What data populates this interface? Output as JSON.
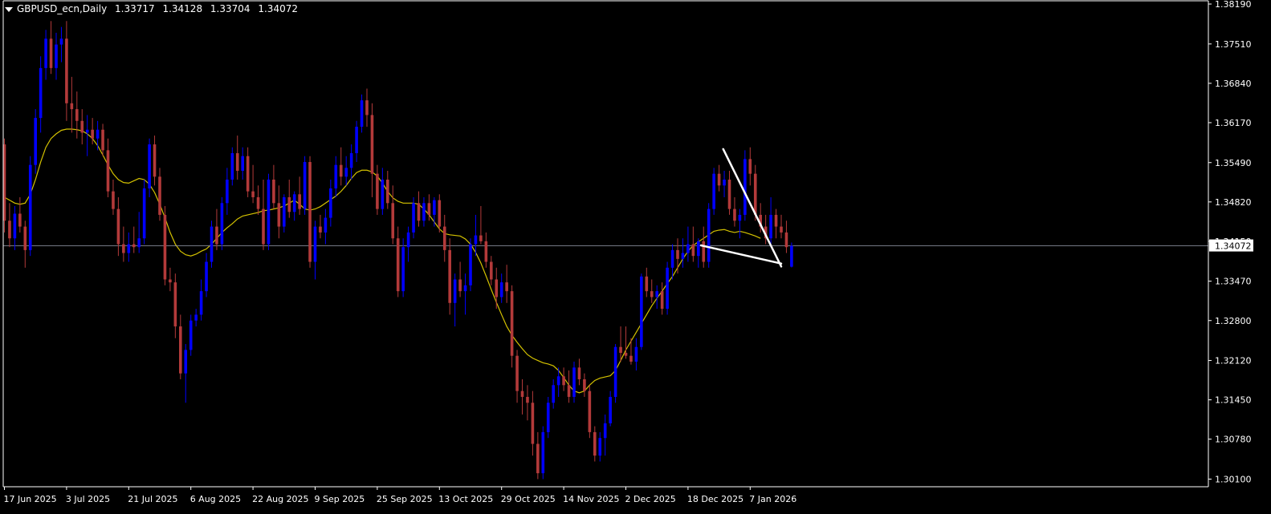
{
  "header": {
    "symbol": "GBPUSD_ecn,Daily",
    "open": "1.33717",
    "high": "1.34128",
    "low": "1.33704",
    "close": "1.34072"
  },
  "colors": {
    "background": "#000000",
    "bull": "#0000ff",
    "bear": "#b33a3a",
    "ma": "#d4c200",
    "axis": "#ffffff",
    "pattern": "#ffffff",
    "price_line": "#9aa0b0"
  },
  "chart_data": {
    "type": "candlestick",
    "y_ticks": [
      "1.38190",
      "1.37510",
      "1.36840",
      "1.36170",
      "1.35490",
      "1.34820",
      "1.34150",
      "1.33470",
      "1.32800",
      "1.32120",
      "1.31450",
      "1.30780",
      "1.30100"
    ],
    "ylim": [
      1.2997,
      1.38245
    ],
    "x_ticks": [
      {
        "label": "17 Jun 2025",
        "index": 0
      },
      {
        "label": "3 Jul 2025",
        "index": 12
      },
      {
        "label": "21 Jul 2025",
        "index": 24
      },
      {
        "label": "6 Aug 2025",
        "index": 36
      },
      {
        "label": "22 Aug 2025",
        "index": 48
      },
      {
        "label": "9 Sep 2025",
        "index": 60
      },
      {
        "label": "25 Sep 2025",
        "index": 72
      },
      {
        "label": "13 Oct 2025",
        "index": 84
      },
      {
        "label": "29 Oct 2025",
        "index": 96
      },
      {
        "label": "14 Nov 2025",
        "index": 108
      },
      {
        "label": "2 Dec 2025",
        "index": 120
      },
      {
        "label": "18 Dec 2025",
        "index": 132
      },
      {
        "label": "7 Jan 2026",
        "index": 144
      }
    ],
    "current_price": "1.34072",
    "candles": [
      [
        1.358,
        1.359,
        1.343,
        1.345
      ],
      [
        1.345,
        1.348,
        1.3405,
        1.342
      ],
      [
        1.342,
        1.3475,
        1.34,
        1.3462
      ],
      [
        1.3462,
        1.349,
        1.343,
        1.344
      ],
      [
        1.344,
        1.345,
        1.337,
        1.34
      ],
      [
        1.34,
        1.356,
        1.339,
        1.3545
      ],
      [
        1.3545,
        1.364,
        1.353,
        1.3625
      ],
      [
        1.3625,
        1.373,
        1.36,
        1.371
      ],
      [
        1.371,
        1.3775,
        1.369,
        1.376
      ],
      [
        1.376,
        1.379,
        1.37,
        1.371
      ],
      [
        1.371,
        1.377,
        1.369,
        1.375
      ],
      [
        1.375,
        1.378,
        1.372,
        1.376
      ],
      [
        1.376,
        1.379,
        1.362,
        1.365
      ],
      [
        1.365,
        1.3695,
        1.36,
        1.364
      ],
      [
        1.364,
        1.367,
        1.359,
        1.362
      ],
      [
        1.362,
        1.364,
        1.358,
        1.36
      ],
      [
        1.36,
        1.363,
        1.356,
        1.3605
      ],
      [
        1.3605,
        1.3625,
        1.358,
        1.359
      ],
      [
        1.359,
        1.362,
        1.357,
        1.3605
      ],
      [
        1.3605,
        1.3615,
        1.356,
        1.357
      ],
      [
        1.357,
        1.359,
        1.349,
        1.35
      ],
      [
        1.35,
        1.352,
        1.346,
        1.347
      ],
      [
        1.347,
        1.349,
        1.339,
        1.341
      ],
      [
        1.341,
        1.344,
        1.338,
        1.3395
      ],
      [
        1.3395,
        1.343,
        1.338,
        1.341
      ],
      [
        1.341,
        1.344,
        1.3395,
        1.3405
      ],
      [
        1.3405,
        1.3465,
        1.3395,
        1.342
      ],
      [
        1.342,
        1.352,
        1.341,
        1.3505
      ],
      [
        1.3505,
        1.359,
        1.349,
        1.358
      ],
      [
        1.358,
        1.3595,
        1.351,
        1.3525
      ],
      [
        1.3525,
        1.354,
        1.345,
        1.346
      ],
      [
        1.346,
        1.3475,
        1.334,
        1.335
      ],
      [
        1.335,
        1.337,
        1.333,
        1.3345
      ],
      [
        1.3345,
        1.336,
        1.325,
        1.327
      ],
      [
        1.327,
        1.329,
        1.318,
        1.319
      ],
      [
        1.319,
        1.324,
        1.314,
        1.323
      ],
      [
        1.323,
        1.329,
        1.322,
        1.328
      ],
      [
        1.328,
        1.33,
        1.327,
        1.329
      ],
      [
        1.329,
        1.335,
        1.328,
        1.333
      ],
      [
        1.333,
        1.3395,
        1.332,
        1.338
      ],
      [
        1.338,
        1.345,
        1.337,
        1.344
      ],
      [
        1.344,
        1.347,
        1.34,
        1.341
      ],
      [
        1.341,
        1.349,
        1.34,
        1.348
      ],
      [
        1.348,
        1.354,
        1.346,
        1.352
      ],
      [
        1.352,
        1.3575,
        1.351,
        1.3565
      ],
      [
        1.3565,
        1.3595,
        1.352,
        1.3535
      ],
      [
        1.3535,
        1.3575,
        1.352,
        1.356
      ],
      [
        1.356,
        1.3575,
        1.349,
        1.35
      ],
      [
        1.35,
        1.3545,
        1.348,
        1.349
      ],
      [
        1.349,
        1.351,
        1.346,
        1.347
      ],
      [
        1.347,
        1.352,
        1.34,
        1.341
      ],
      [
        1.341,
        1.353,
        1.34,
        1.352
      ],
      [
        1.352,
        1.3545,
        1.347,
        1.348
      ],
      [
        1.348,
        1.351,
        1.342,
        1.344
      ],
      [
        1.344,
        1.3495,
        1.343,
        1.349
      ],
      [
        1.349,
        1.352,
        1.3455,
        1.3465
      ],
      [
        1.3465,
        1.35,
        1.345,
        1.3495
      ],
      [
        1.3495,
        1.3525,
        1.346,
        1.347
      ],
      [
        1.347,
        1.356,
        1.346,
        1.355
      ],
      [
        1.355,
        1.356,
        1.337,
        1.338
      ],
      [
        1.338,
        1.345,
        1.335,
        1.344
      ],
      [
        1.344,
        1.346,
        1.342,
        1.343
      ],
      [
        1.343,
        1.347,
        1.341,
        1.3455
      ],
      [
        1.3455,
        1.352,
        1.344,
        1.3505
      ],
      [
        1.3505,
        1.356,
        1.349,
        1.3545
      ],
      [
        1.3545,
        1.3575,
        1.351,
        1.3525
      ],
      [
        1.3525,
        1.356,
        1.351,
        1.354
      ],
      [
        1.354,
        1.358,
        1.352,
        1.3565
      ],
      [
        1.3565,
        1.362,
        1.355,
        1.361
      ],
      [
        1.361,
        1.3665,
        1.36,
        1.3655
      ],
      [
        1.3655,
        1.3675,
        1.361,
        1.363
      ],
      [
        1.363,
        1.365,
        1.349,
        1.353
      ],
      [
        1.353,
        1.3545,
        1.346,
        1.347
      ],
      [
        1.347,
        1.354,
        1.346,
        1.352
      ],
      [
        1.352,
        1.3535,
        1.347,
        1.348
      ],
      [
        1.348,
        1.351,
        1.341,
        1.342
      ],
      [
        1.342,
        1.344,
        1.332,
        1.333
      ],
      [
        1.333,
        1.342,
        1.332,
        1.3405
      ],
      [
        1.3405,
        1.344,
        1.338,
        1.343
      ],
      [
        1.343,
        1.349,
        1.342,
        1.348
      ],
      [
        1.348,
        1.35,
        1.344,
        1.345
      ],
      [
        1.345,
        1.349,
        1.344,
        1.348
      ],
      [
        1.348,
        1.3495,
        1.345,
        1.346
      ],
      [
        1.346,
        1.349,
        1.344,
        1.3485
      ],
      [
        1.3485,
        1.3495,
        1.343,
        1.344
      ],
      [
        1.344,
        1.346,
        1.338,
        1.34
      ],
      [
        1.34,
        1.342,
        1.329,
        1.331
      ],
      [
        1.331,
        1.336,
        1.327,
        1.335
      ],
      [
        1.335,
        1.338,
        1.332,
        1.333
      ],
      [
        1.333,
        1.336,
        1.329,
        1.334
      ],
      [
        1.334,
        1.342,
        1.333,
        1.341
      ],
      [
        1.341,
        1.346,
        1.339,
        1.3425
      ],
      [
        1.3425,
        1.3475,
        1.341,
        1.3415
      ],
      [
        1.3415,
        1.343,
        1.337,
        1.338
      ],
      [
        1.338,
        1.339,
        1.334,
        1.335
      ],
      [
        1.335,
        1.337,
        1.33,
        1.332
      ],
      [
        1.332,
        1.336,
        1.331,
        1.3345
      ],
      [
        1.3345,
        1.3375,
        1.331,
        1.333
      ],
      [
        1.333,
        1.334,
        1.32,
        1.322
      ],
      [
        1.322,
        1.323,
        1.314,
        1.316
      ],
      [
        1.316,
        1.318,
        1.312,
        1.315
      ],
      [
        1.315,
        1.317,
        1.311,
        1.314
      ],
      [
        1.314,
        1.316,
        1.305,
        1.307
      ],
      [
        1.307,
        1.309,
        1.301,
        1.302
      ],
      [
        1.302,
        1.31,
        1.301,
        1.309
      ],
      [
        1.309,
        1.315,
        1.308,
        1.314
      ],
      [
        1.314,
        1.318,
        1.313,
        1.317
      ],
      [
        1.317,
        1.32,
        1.315,
        1.3185
      ],
      [
        1.3185,
        1.32,
        1.316,
        1.317
      ],
      [
        1.317,
        1.3195,
        1.314,
        1.315
      ],
      [
        1.315,
        1.321,
        1.314,
        1.32
      ],
      [
        1.32,
        1.3215,
        1.317,
        1.318
      ],
      [
        1.318,
        1.319,
        1.315,
        1.316
      ],
      [
        1.316,
        1.317,
        1.308,
        1.309
      ],
      [
        1.309,
        1.31,
        1.304,
        1.305
      ],
      [
        1.305,
        1.309,
        1.304,
        1.308
      ],
      [
        1.308,
        1.312,
        1.305,
        1.3105
      ],
      [
        1.3105,
        1.316,
        1.31,
        1.315
      ],
      [
        1.315,
        1.324,
        1.314,
        1.3235
      ],
      [
        1.3235,
        1.327,
        1.321,
        1.3225
      ],
      [
        1.3225,
        1.327,
        1.3215,
        1.322
      ],
      [
        1.322,
        1.325,
        1.3205,
        1.321
      ],
      [
        1.321,
        1.325,
        1.3195,
        1.3235
      ],
      [
        1.3235,
        1.336,
        1.323,
        1.3355
      ],
      [
        1.3355,
        1.337,
        1.332,
        1.333
      ],
      [
        1.333,
        1.335,
        1.331,
        1.332
      ],
      [
        1.332,
        1.334,
        1.33,
        1.333
      ],
      [
        1.333,
        1.3345,
        1.329,
        1.33
      ],
      [
        1.33,
        1.338,
        1.329,
        1.337
      ],
      [
        1.337,
        1.341,
        1.335,
        1.34
      ],
      [
        1.34,
        1.342,
        1.336,
        1.3385
      ],
      [
        1.3385,
        1.342,
        1.337,
        1.3395
      ],
      [
        1.3395,
        1.344,
        1.338,
        1.341
      ],
      [
        1.341,
        1.344,
        1.338,
        1.339
      ],
      [
        1.339,
        1.342,
        1.337,
        1.3415
      ],
      [
        1.3415,
        1.344,
        1.337,
        1.338
      ],
      [
        1.338,
        1.348,
        1.337,
        1.347
      ],
      [
        1.347,
        1.354,
        1.346,
        1.353
      ],
      [
        1.353,
        1.3545,
        1.35,
        1.351
      ],
      [
        1.351,
        1.3535,
        1.349,
        1.352
      ],
      [
        1.352,
        1.3535,
        1.346,
        1.347
      ],
      [
        1.347,
        1.349,
        1.344,
        1.345
      ],
      [
        1.345,
        1.347,
        1.342,
        1.346
      ],
      [
        1.346,
        1.357,
        1.345,
        1.3555
      ],
      [
        1.3555,
        1.3575,
        1.351,
        1.353
      ],
      [
        1.353,
        1.3545,
        1.345,
        1.346
      ],
      [
        1.346,
        1.348,
        1.343,
        1.344
      ],
      [
        1.344,
        1.346,
        1.341,
        1.342
      ],
      [
        1.342,
        1.349,
        1.341,
        1.346
      ],
      [
        1.346,
        1.347,
        1.342,
        1.344
      ],
      [
        1.344,
        1.346,
        1.342,
        1.343
      ],
      [
        1.343,
        1.345,
        1.3395,
        1.3405
      ],
      [
        1.33717,
        1.34128,
        1.33704,
        1.34072
      ]
    ],
    "moving_average": [
      1.349,
      1.3485,
      1.348,
      1.3478,
      1.348,
      1.3495,
      1.352,
      1.355,
      1.3575,
      1.359,
      1.3598,
      1.3604,
      1.3606,
      1.3606,
      1.3605,
      1.3603,
      1.3598,
      1.359,
      1.3578,
      1.3562,
      1.3545,
      1.353,
      1.352,
      1.3515,
      1.3514,
      1.3518,
      1.3522,
      1.352,
      1.3512,
      1.3498,
      1.3478,
      1.3455,
      1.343,
      1.341,
      1.3398,
      1.3392,
      1.339,
      1.3393,
      1.3398,
      1.3402,
      1.341,
      1.342,
      1.343,
      1.3438,
      1.3445,
      1.3453,
      1.3458,
      1.346,
      1.3462,
      1.3464,
      1.3467,
      1.3468,
      1.347,
      1.3472,
      1.3475,
      1.348,
      1.3485,
      1.3478,
      1.347,
      1.3468,
      1.347,
      1.3474,
      1.348,
      1.3486,
      1.3492,
      1.35,
      1.351,
      1.3522,
      1.3532,
      1.3536,
      1.3536,
      1.3533,
      1.3526,
      1.3514,
      1.35,
      1.3489,
      1.3483,
      1.348,
      1.348,
      1.348,
      1.3478,
      1.347,
      1.346,
      1.3448,
      1.3436,
      1.3428,
      1.3426,
      1.3425,
      1.3424,
      1.3419,
      1.341,
      1.3396,
      1.3378,
      1.3356,
      1.3333,
      1.3311,
      1.329,
      1.327,
      1.3255,
      1.3243,
      1.3232,
      1.3222,
      1.3216,
      1.3212,
      1.3208,
      1.3206,
      1.3203,
      1.3195,
      1.3183,
      1.317,
      1.316,
      1.3157,
      1.316,
      1.317,
      1.3178,
      1.3182,
      1.3184,
      1.3186,
      1.3195,
      1.3212,
      1.323,
      1.3245,
      1.326,
      1.3275,
      1.329,
      1.3305,
      1.3318,
      1.333,
      1.3343,
      1.3355,
      1.337,
      1.3385,
      1.3398,
      1.3408,
      1.3414,
      1.342,
      1.3426,
      1.3432,
      1.3434,
      1.3435,
      1.3432,
      1.343,
      1.3432,
      1.343,
      1.3427,
      1.3424,
      1.342
    ],
    "pattern_lines": [
      {
        "from_index": 138.8,
        "from_price": 1.3572,
        "to_index": 150,
        "to_price": 1.3372
      },
      {
        "from_index": 134.5,
        "from_price": 1.3408,
        "to_index": 150,
        "to_price": 1.3377
      }
    ]
  }
}
